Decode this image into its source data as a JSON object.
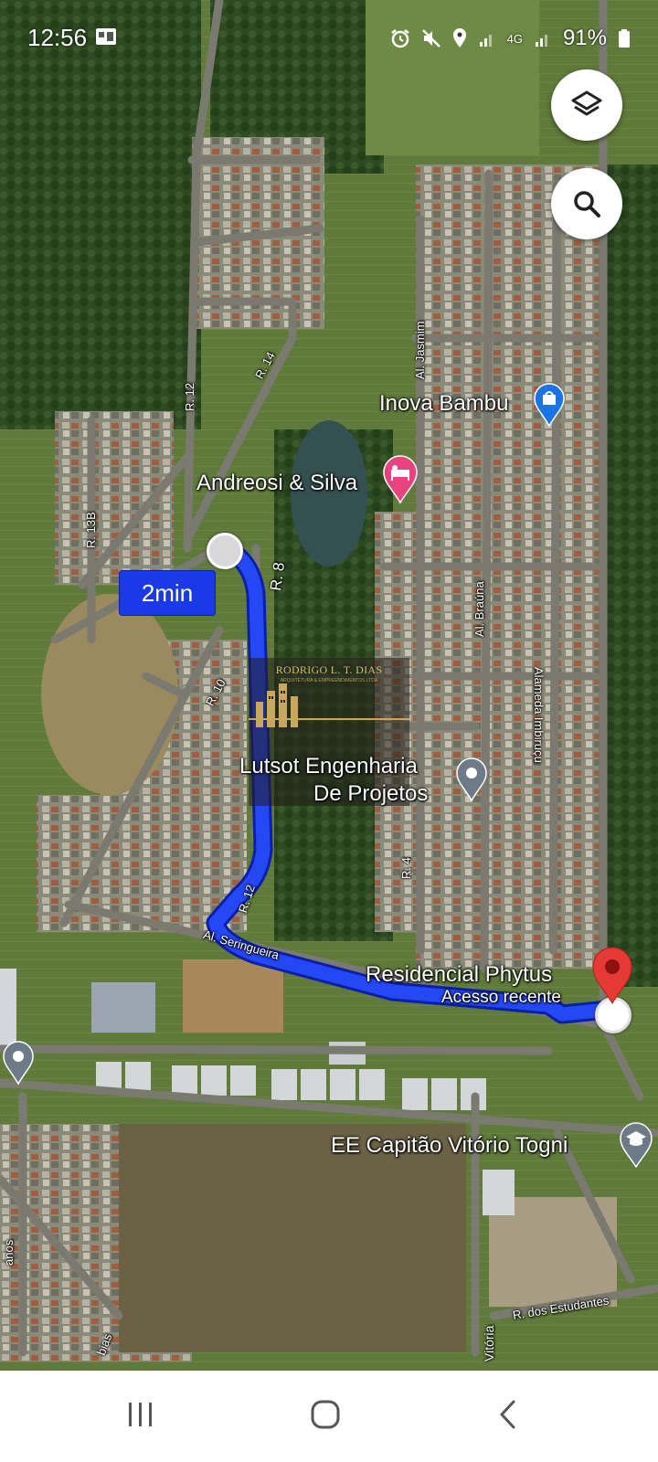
{
  "status_bar": {
    "time": "12:56",
    "network": "4G",
    "battery": "91%"
  },
  "map": {
    "places": [
      {
        "id": "inova-bambu",
        "label": "Inova Bambu",
        "icon": "shopping-bag-icon",
        "color": "#1a73e8"
      },
      {
        "id": "andreosi-silva",
        "label": "Andreosi & Silva",
        "icon": "bed-icon",
        "color": "#e8437e"
      },
      {
        "id": "lutsot",
        "label_line1": "Lutsot Engenharia",
        "label_line2": "De Projetos",
        "icon": "location-dot-icon",
        "color": "#6d7a87"
      },
      {
        "id": "residencial",
        "label": "Residencial Phytus",
        "sublabel": "Acesso recente",
        "icon": "red-destination-pin-icon",
        "color": "#d93025"
      },
      {
        "id": "ee-capitao",
        "label": "EE Capitão Vitório Togni",
        "icon": "graduation-cap-icon",
        "color": "#6d7a87"
      }
    ],
    "streets": {
      "r12_top": "R. 12",
      "r14": "R. 14",
      "r13b": "R. 13B",
      "r8": "R. 8",
      "r10": "R. 10",
      "r12_mid": "R. 12",
      "r4": "R. 4",
      "al_jasmim": "Al. Jasmim",
      "al_brauna": "Al. Braúna",
      "alameda_imbirucu": "Alameda Imbiruçu",
      "al_seringueira": "Al. Seringueira",
      "r_estudantes": "R. dos Estudantes",
      "vitoria": "Vitória",
      "bias": "bias",
      "anos": "anos"
    },
    "route": {
      "duration": "2min",
      "color": "#1f3df0"
    },
    "watermark": {
      "name": "RODRIGO L. T. DIAS",
      "tagline": "ARQUITETURA & EMPREENDIMENTOS LTDA"
    }
  },
  "controls": {
    "layers": "layers-icon",
    "search": "search-icon"
  },
  "nav_bar": {
    "recents": "recents-icon",
    "home": "home-icon",
    "back": "back-icon"
  }
}
